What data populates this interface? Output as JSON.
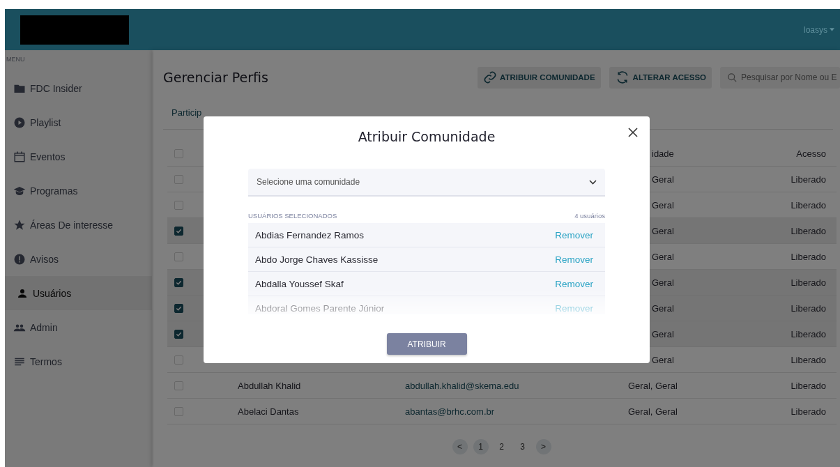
{
  "topbar": {
    "user": "loasys"
  },
  "sidebar": {
    "heading": "MENU",
    "items": [
      {
        "label": "FDC Insider",
        "selected": false
      },
      {
        "label": "Playlist",
        "selected": false
      },
      {
        "label": "Eventos",
        "selected": false
      },
      {
        "label": "Programas",
        "selected": false
      },
      {
        "label": "Áreas De interesse",
        "selected": false
      },
      {
        "label": "Avisos",
        "selected": false
      },
      {
        "label": "Usuários",
        "selected": true
      },
      {
        "label": "Admin",
        "selected": false
      },
      {
        "label": "Termos",
        "selected": false
      }
    ]
  },
  "page": {
    "title": "Gerenciar Perfis"
  },
  "toolbar": {
    "buttons": [
      "ATRIBUIR COMUNIDADE",
      "ALTERAR ACESSO"
    ],
    "search": {
      "placeholder": "Pesquisar por Nome ou E"
    }
  },
  "tabs": [
    {
      "label": "Particip",
      "selected": true
    }
  ],
  "table": {
    "header": {
      "checked": false,
      "community": "idade",
      "access": "Acesso"
    },
    "rows": [
      {
        "kind": "covered",
        "checked": false,
        "community": "Geral",
        "access": "Liberado"
      },
      {
        "kind": "covered",
        "checked": false,
        "community": "Geral",
        "access": "Liberado"
      },
      {
        "kind": "covered",
        "checked": true,
        "community": "Geral",
        "access": "Liberado"
      },
      {
        "kind": "covered",
        "checked": false,
        "community": "Geral",
        "access": "Liberado"
      },
      {
        "kind": "covered",
        "checked": true,
        "community": "Geral",
        "access": "Liberado"
      },
      {
        "kind": "covered",
        "checked": true,
        "community": "Geral",
        "access": "Liberado"
      },
      {
        "kind": "covered",
        "checked": true,
        "community": "Geral",
        "access": "Liberado"
      },
      {
        "kind": "covered",
        "checked": false,
        "community": "Geral",
        "access": "Liberado"
      },
      {
        "kind": "full",
        "checked": false,
        "name": "Abdullah Khalid",
        "email": "abdullah.khalid@skema.edu",
        "community": "Geral, Geral",
        "access": "Liberado"
      },
      {
        "kind": "full",
        "checked": false,
        "name": "Abelaci Dantas",
        "email": "abantas@brhc.com.br",
        "community": "Geral, Geral",
        "access": "Liberado"
      }
    ]
  },
  "pagination": [
    {
      "kind": "arrow",
      "label": "<"
    },
    {
      "kind": "page",
      "label": "1",
      "selected": true
    },
    {
      "kind": "page",
      "label": "2",
      "selected": false
    },
    {
      "kind": "page",
      "label": "3",
      "selected": false
    },
    {
      "kind": "arrow",
      "label": ">"
    }
  ],
  "modal": {
    "title": "Atribuir Comunidade",
    "select": {
      "placeholder": "Selecione uma comunidade"
    },
    "list_label": "USUÁRIOS SELECIONADOS",
    "count": "4 usuários",
    "users": [
      {
        "name": "Abdias Fernandez Ramos",
        "action": "Remover"
      },
      {
        "name": "Abdo Jorge Chaves Kassisse",
        "action": "Remover"
      },
      {
        "name": "Abdalla Youssef Skaf",
        "action": "Remover"
      },
      {
        "name": "Abdoral Gomes Parente Júnior",
        "action": "Remover"
      }
    ],
    "submit": "ATRIBUIR"
  }
}
